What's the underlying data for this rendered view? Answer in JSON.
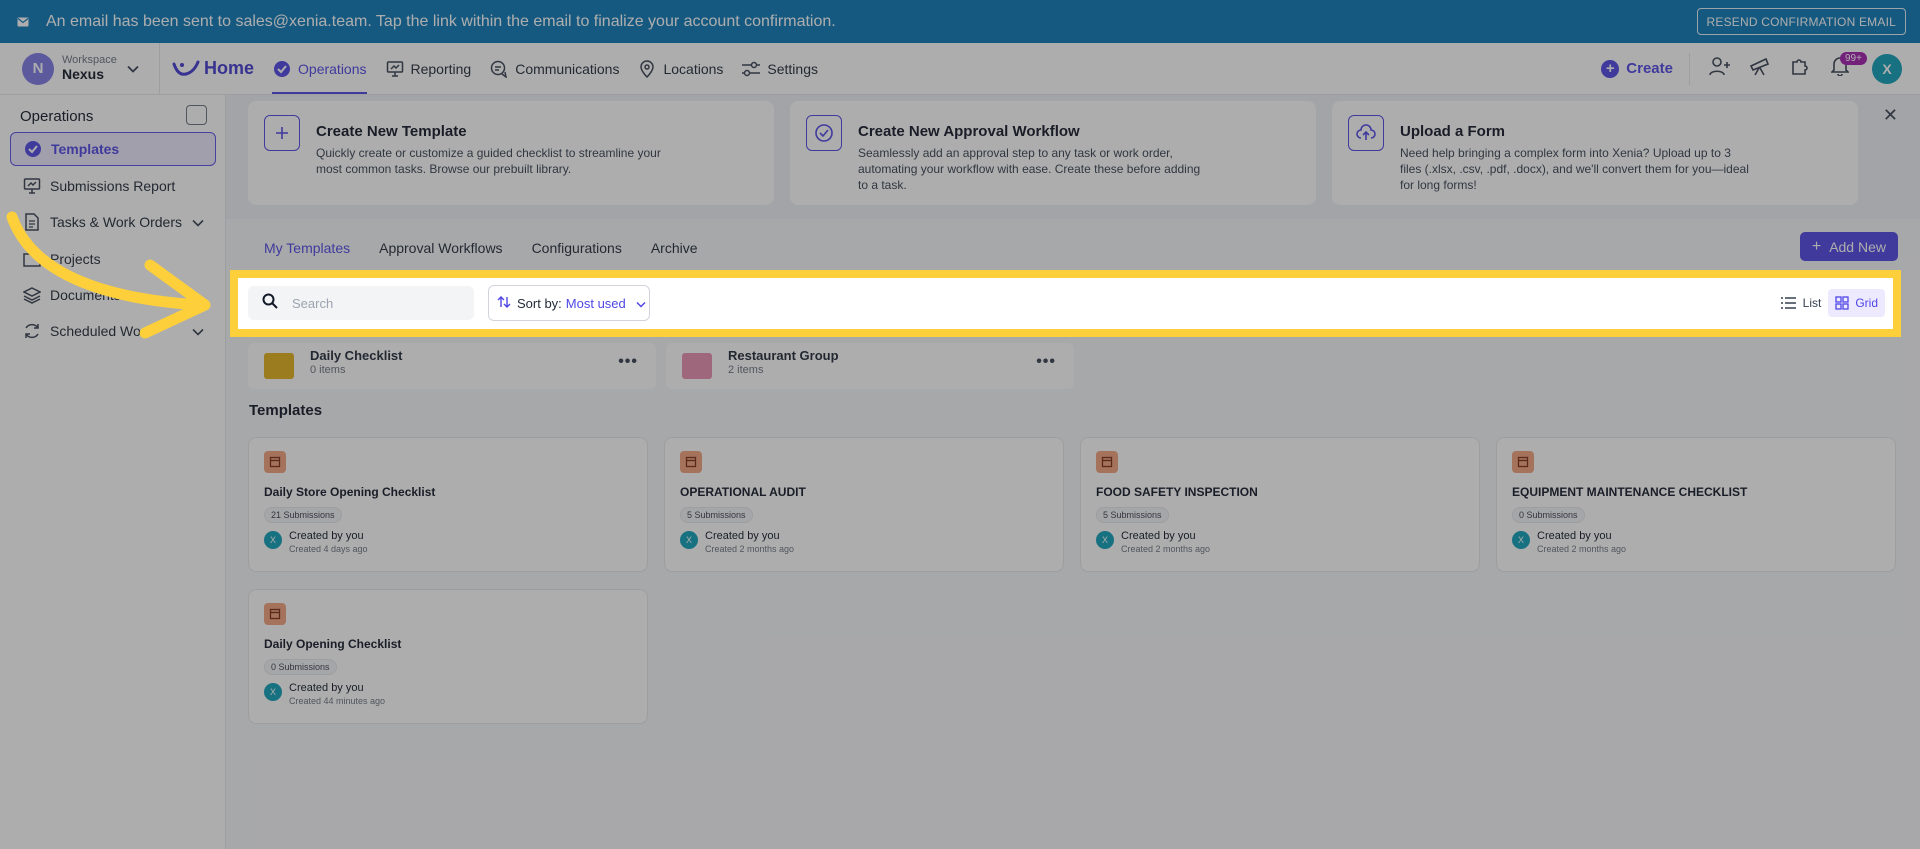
{
  "banner": {
    "message": "An email has been sent to sales@xenia.team. Tap the link within the email to finalize your account confirmation.",
    "resend_label": "RESEND CONFIRMATION EMAIL"
  },
  "workspace": {
    "initial": "N",
    "label": "Workspace",
    "name": "Nexus"
  },
  "nav": {
    "home": "Home",
    "operations": "Operations",
    "reporting": "Reporting",
    "communications": "Communications",
    "locations": "Locations",
    "settings": "Settings",
    "create": "Create",
    "notifications_badge": "99+",
    "user_initial": "X"
  },
  "sidebar": {
    "title": "Operations",
    "items": [
      {
        "label": "Templates"
      },
      {
        "label": "Submissions Report"
      },
      {
        "label": "Tasks & Work Orders"
      },
      {
        "label": "Projects"
      },
      {
        "label": "Documents"
      },
      {
        "label": "Scheduled Wo"
      }
    ]
  },
  "create_cards": [
    {
      "title": "Create New Template",
      "desc": "Quickly create or customize a guided checklist to streamline your most common tasks. Browse our prebuilt library."
    },
    {
      "title": "Create New Approval Workflow",
      "desc": "Seamlessly add an approval step to any task or work order, automating your workflow with ease. Create these before adding to a task."
    },
    {
      "title": "Upload a Form",
      "desc": "Need help bringing a complex form into Xenia? Upload up to 3 files (.xlsx, .csv, .pdf, .docx), and we'll convert them for you—ideal for long forms!"
    }
  ],
  "tabs": [
    "My Templates",
    "Approval Workflows",
    "Configurations",
    "Archive"
  ],
  "add_new": "Add New",
  "toolbar": {
    "search_placeholder": "Search",
    "sort_label": "Sort by:",
    "sort_value": "Most used",
    "list_label": "List",
    "grid_label": "Grid"
  },
  "folders": [
    {
      "name": "Daily Checklist",
      "count": "0 items",
      "color": "#e3b01b"
    },
    {
      "name": "Restaurant Group",
      "count": "2 items",
      "color": "#e98fb0"
    }
  ],
  "templates_heading": "Templates",
  "templates": [
    {
      "name": "Daily Store Opening Checklist",
      "submissions": "21 Submissions",
      "created_by": "Created by you",
      "created_at": "Created 4 days ago"
    },
    {
      "name": "OPERATIONAL AUDIT",
      "submissions": "5 Submissions",
      "created_by": "Created by you",
      "created_at": "Created 2 months ago"
    },
    {
      "name": "FOOD SAFETY INSPECTION",
      "submissions": "5 Submissions",
      "created_by": "Created by you",
      "created_at": "Created 2 months ago"
    },
    {
      "name": "EQUIPMENT MAINTENANCE CHECKLIST",
      "submissions": "0 Submissions",
      "created_by": "Created by you",
      "created_at": "Created 2 months ago"
    },
    {
      "name": "Daily Opening Checklist",
      "submissions": "0 Submissions",
      "created_by": "Created by you",
      "created_at": "Created 44 minutes ago"
    }
  ],
  "colors": {
    "accent": "#4f46e5",
    "banner": "#0b78b8",
    "highlight": "#fdd03b"
  }
}
